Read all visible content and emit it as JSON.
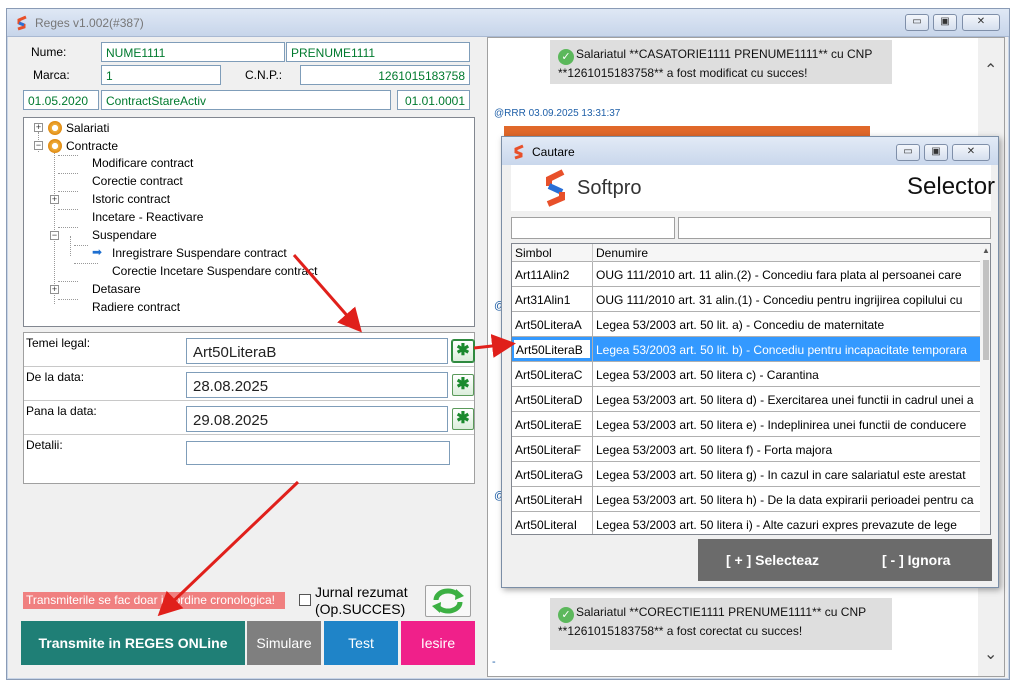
{
  "window": {
    "title": "Reges v1.002(#387)",
    "btn_min": "▭",
    "btn_max": "▣",
    "btn_close": "✕"
  },
  "employee": {
    "nume_label": "Nume:",
    "nume_value": "NUME1111",
    "prenume_value": "PRENUME1111",
    "marca_label": "Marca:",
    "marca_value": "1",
    "cnp_label": "C.N.P.:",
    "cnp_value": "1261015183758",
    "date_start": "01.05.2020",
    "contract_state": "ContractStareActiv",
    "date_end": "01.01.0001"
  },
  "tree": {
    "salariati": "Salariati",
    "contracte": "Contracte",
    "modificare": "Modificare contract",
    "corectie": "Corectie contract",
    "istoric": "Istoric contract",
    "incetare": "Incetare - Reactivare",
    "suspendare": "Suspendare",
    "inregistrare_susp": "Inregistrare Suspendare contract",
    "corectie_incetare_susp": "Corectie Incetare Suspendare contract",
    "detasare": "Detasare",
    "radiere": "Radiere contract"
  },
  "form": {
    "temei_label": "Temei legal:",
    "temei_value": "Art50LiteraB",
    "de_la_label": "De la data:",
    "de_la_value": "28.08.2025",
    "pana_la_label": "Pana la data:",
    "pana_la_value": "29.08.2025",
    "detalii_label": "Detalii:",
    "detalii_value": "",
    "pick_glyph": "✱"
  },
  "bottom": {
    "warning": "Transmiterile se fac doar in ordine cronologica!",
    "jurnal_label_1": "Jurnal rezumat",
    "jurnal_label_2": "(Op.SUCCES)",
    "transmite": "Transmite in REGES ONLine",
    "simulare": "Simulare",
    "test": "Test",
    "iesire": "Iesire"
  },
  "log": {
    "msg1_line1": "Salariatul **CASATORIE1111 PRENUME1111** cu CNP",
    "msg1_line2": "**1261015183758** a fost modificat cu succes!",
    "stamp": "@RRR 03.09.2025 13:31:37",
    "at1": "@",
    "at2": "@",
    "msg2_line1": "Salariatul **CORECTIE1111 PRENUME1111** cu CNP",
    "msg2_line2": "**1261015183758** a fost corectat cu succes!",
    "dash": "-"
  },
  "dialog": {
    "title": "Cautare",
    "brand": "Softpro",
    "heading": "Selector",
    "col_simbol": "Simbol",
    "col_denumire": "Denumire",
    "rows": [
      {
        "simbol": "Art11Alin2",
        "denumire": "OUG 111/2010 art. 11 alin.(2) - Concediu fara plata al persoanei care"
      },
      {
        "simbol": "Art31Alin1",
        "denumire": "OUG 111/2010 art. 31 alin.(1) - Concediu pentru ingrijirea copilului cu"
      },
      {
        "simbol": "Art50LiteraA",
        "denumire": "Legea 53/2003 art. 50 lit. a) - Concediu de maternitate"
      },
      {
        "simbol": "Art50LiteraB",
        "denumire": "Legea 53/2003 art. 50 lit. b) - Concediu pentru incapacitate temporara"
      },
      {
        "simbol": "Art50LiteraC",
        "denumire": "Legea 53/2003 art. 50 litera c) - Carantina"
      },
      {
        "simbol": "Art50LiteraD",
        "denumire": "Legea 53/2003 art. 50 litera d) - Exercitarea unei functii in cadrul unei a"
      },
      {
        "simbol": "Art50LiteraE",
        "denumire": "Legea 53/2003 art. 50 litera e) - Indeplinirea unei functii de conducere"
      },
      {
        "simbol": "Art50LiteraF",
        "denumire": "Legea 53/2003 art. 50 litera f) - Forta majora"
      },
      {
        "simbol": "Art50LiteraG",
        "denumire": "Legea 53/2003 art. 50 litera g) - In cazul in care salariatul este arestat"
      },
      {
        "simbol": "Art50LiteraH",
        "denumire": "Legea 53/2003 art. 50 litera h) - De la data expirarii perioadei pentru ca"
      },
      {
        "simbol": "Art50LiteraI",
        "denumire": "Legea 53/2003 art. 50 litera i) - Alte cazuri expres prevazute de lege"
      }
    ],
    "selecteaza": "[ + ]  Selecteaz",
    "ignora": "[ - ]  Ignora"
  },
  "colors": {
    "transmite_bg": "#1f7f76",
    "simulare_bg": "#7f7f7f",
    "test_bg": "#1f84c8",
    "iesire_bg": "#f0208a",
    "warning_bg": "#f08080",
    "arrow": "#e0201b"
  }
}
